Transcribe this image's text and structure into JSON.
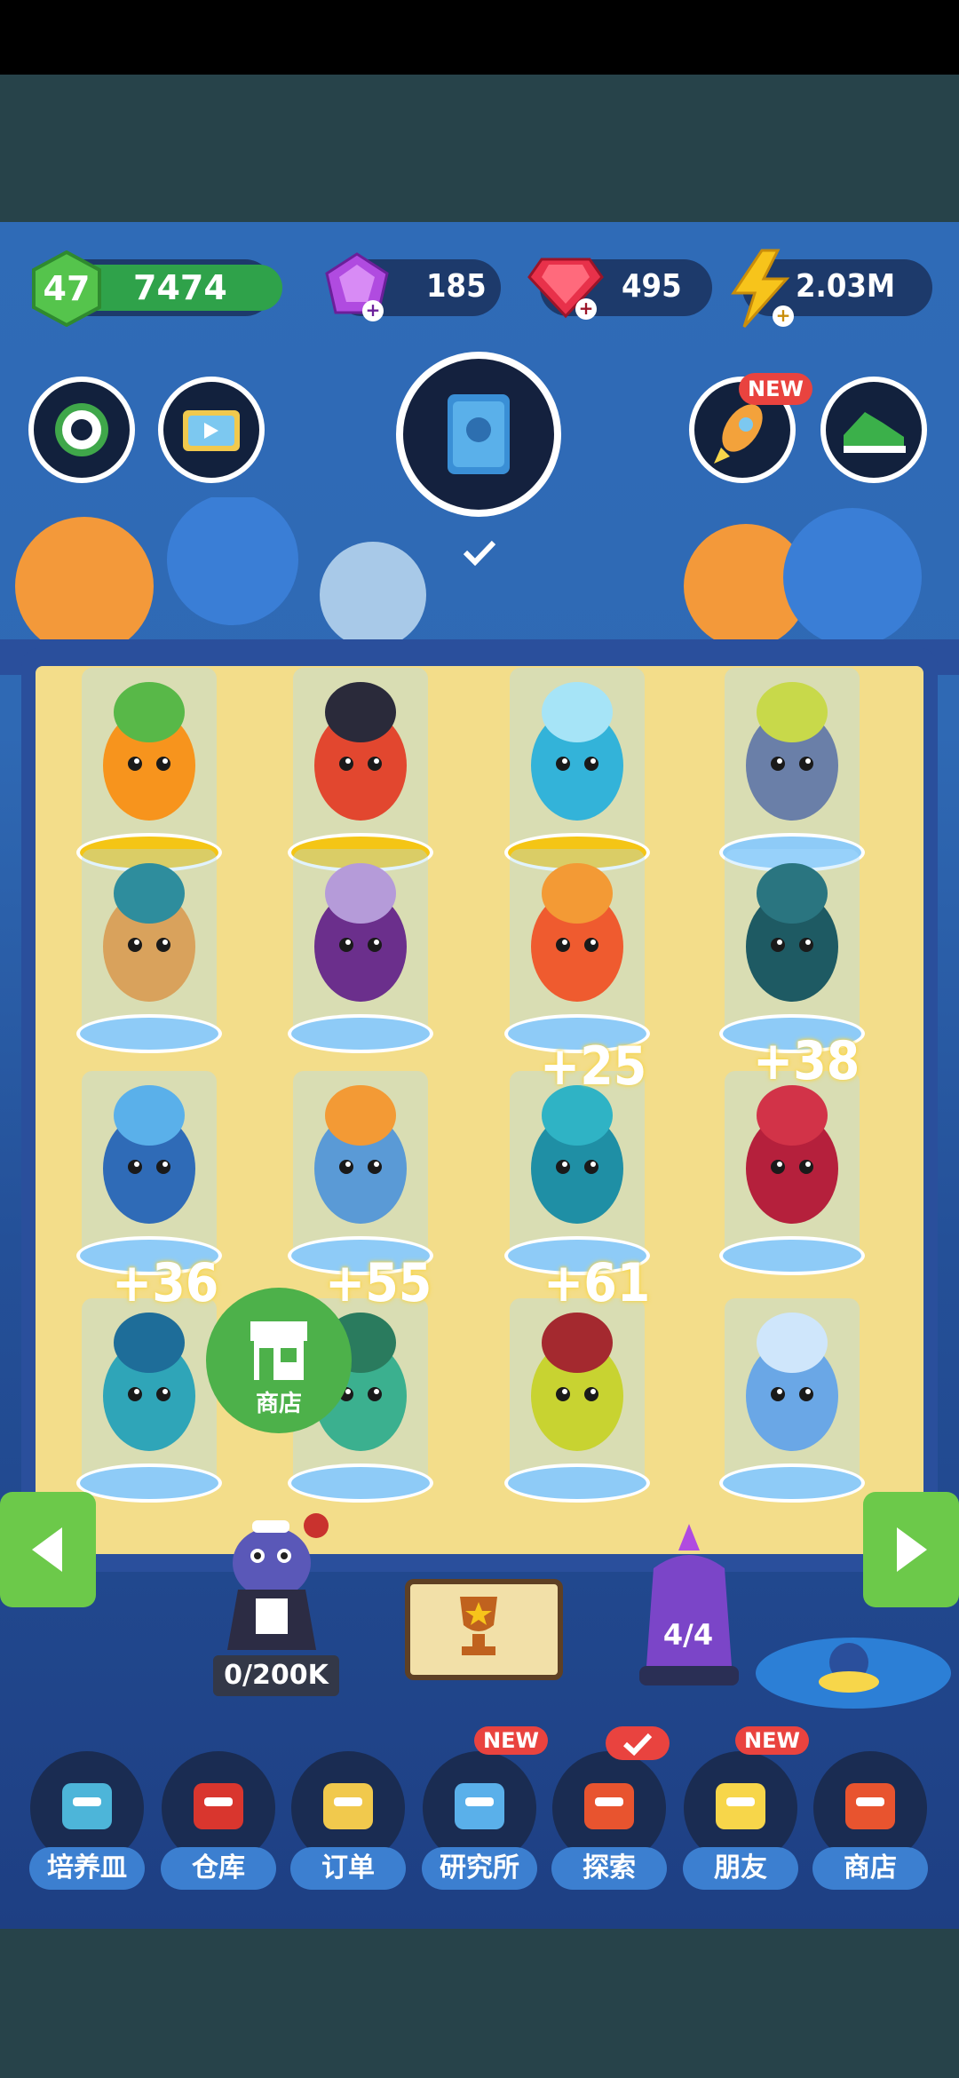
{
  "resources": {
    "level": "47",
    "coins": "7474",
    "gems": "185",
    "rubies": "495",
    "energy": "2.03M",
    "level_progress": 0.85
  },
  "top_buttons": {
    "rocket_new_tag": "NEW"
  },
  "plants": [
    {
      "row": 0,
      "col": 0,
      "base": "gold"
    },
    {
      "row": 0,
      "col": 1,
      "base": "gold"
    },
    {
      "row": 0,
      "col": 2,
      "base": "gold"
    },
    {
      "row": 0,
      "col": 3,
      "base": "blue"
    },
    {
      "row": 1,
      "col": 0,
      "base": "blue"
    },
    {
      "row": 1,
      "col": 1,
      "base": "blue"
    },
    {
      "row": 1,
      "col": 2,
      "base": "blue"
    },
    {
      "row": 1,
      "col": 3,
      "base": "blue"
    },
    {
      "row": 2,
      "col": 0,
      "base": "blue"
    },
    {
      "row": 2,
      "col": 1,
      "base": "blue"
    },
    {
      "row": 2,
      "col": 2,
      "base": "blue"
    },
    {
      "row": 2,
      "col": 3,
      "base": "blue"
    },
    {
      "row": 3,
      "col": 0,
      "base": "blue"
    },
    {
      "row": 3,
      "col": 1,
      "base": "blue"
    },
    {
      "row": 3,
      "col": 2,
      "base": "blue"
    },
    {
      "row": 3,
      "col": 3,
      "base": "blue"
    }
  ],
  "boosts": [
    "+25",
    "+38",
    "+36",
    "+55",
    "+61"
  ],
  "shop_float_label": "商店",
  "storage_capacity": "0/200K",
  "crystal_count": "4/4",
  "bottom_menu": [
    {
      "label": "培养皿",
      "tag": ""
    },
    {
      "label": "仓库",
      "tag": ""
    },
    {
      "label": "订单",
      "tag": ""
    },
    {
      "label": "研究所",
      "tag": "NEW"
    },
    {
      "label": "探索",
      "tag": "check"
    },
    {
      "label": "朋友",
      "tag": "NEW"
    },
    {
      "label": "商店",
      "tag": ""
    }
  ],
  "colors": {
    "accent_green": "#6cc94a",
    "badge_red": "#e9433f",
    "sand": "#f3dd8a",
    "ocean_blue": "#2f6bb7"
  }
}
